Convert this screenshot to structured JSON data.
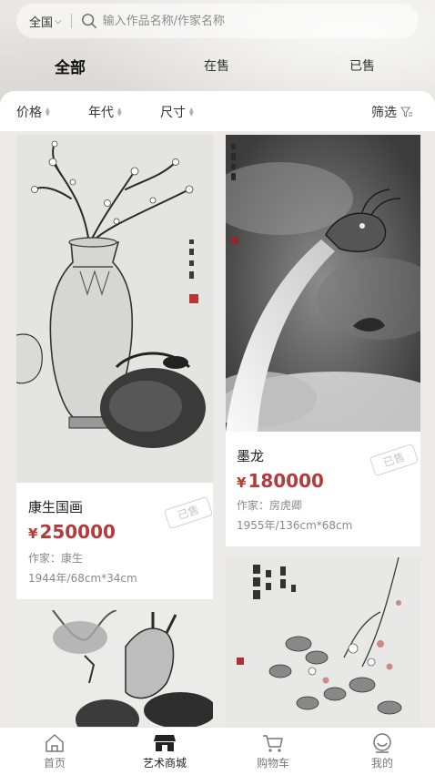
{
  "search": {
    "region": "全国",
    "placeholder": "输入作品名称/作家名称"
  },
  "tabs": [
    {
      "label": "全部",
      "active": true
    },
    {
      "label": "在售",
      "active": false
    },
    {
      "label": "已售",
      "active": false
    }
  ],
  "sort_bar": {
    "items": [
      "价格",
      "年代",
      "尺寸"
    ],
    "filter_label": "筛选"
  },
  "artworks": [
    {
      "title": "康生国画",
      "currency": "¥",
      "price": "250000",
      "artist": "作家：康生",
      "info": "1944年/68cm*34cm",
      "stamp": "已售"
    },
    {
      "title": "墨龙",
      "currency": "¥",
      "price": "180000",
      "artist": "作家：房虎卿",
      "info": "1955年/136cm*68cm",
      "stamp": "已售"
    }
  ],
  "bottom_nav": [
    {
      "label": "首页",
      "icon": "home-icon",
      "active": false
    },
    {
      "label": "艺术商城",
      "icon": "shop-icon",
      "active": true
    },
    {
      "label": "购物车",
      "icon": "cart-icon",
      "active": false
    },
    {
      "label": "我的",
      "icon": "user-icon",
      "active": false
    }
  ],
  "colors": {
    "price": "#b53b3b",
    "background": "#ecebe9"
  }
}
